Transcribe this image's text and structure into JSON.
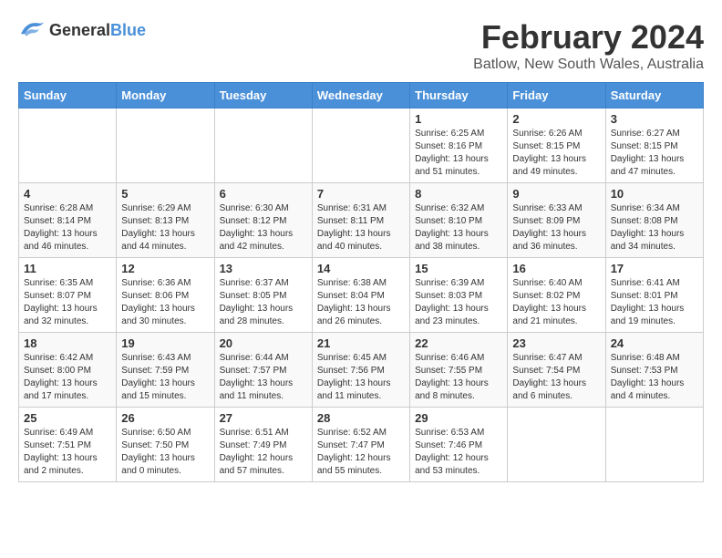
{
  "logo": {
    "general": "General",
    "blue": "Blue"
  },
  "title": "February 2024",
  "subtitle": "Batlow, New South Wales, Australia",
  "weekdays": [
    "Sunday",
    "Monday",
    "Tuesday",
    "Wednesday",
    "Thursday",
    "Friday",
    "Saturday"
  ],
  "weeks": [
    [
      {
        "day": "",
        "info": ""
      },
      {
        "day": "",
        "info": ""
      },
      {
        "day": "",
        "info": ""
      },
      {
        "day": "",
        "info": ""
      },
      {
        "day": "1",
        "info": "Sunrise: 6:25 AM\nSunset: 8:16 PM\nDaylight: 13 hours\nand 51 minutes."
      },
      {
        "day": "2",
        "info": "Sunrise: 6:26 AM\nSunset: 8:15 PM\nDaylight: 13 hours\nand 49 minutes."
      },
      {
        "day": "3",
        "info": "Sunrise: 6:27 AM\nSunset: 8:15 PM\nDaylight: 13 hours\nand 47 minutes."
      }
    ],
    [
      {
        "day": "4",
        "info": "Sunrise: 6:28 AM\nSunset: 8:14 PM\nDaylight: 13 hours\nand 46 minutes."
      },
      {
        "day": "5",
        "info": "Sunrise: 6:29 AM\nSunset: 8:13 PM\nDaylight: 13 hours\nand 44 minutes."
      },
      {
        "day": "6",
        "info": "Sunrise: 6:30 AM\nSunset: 8:12 PM\nDaylight: 13 hours\nand 42 minutes."
      },
      {
        "day": "7",
        "info": "Sunrise: 6:31 AM\nSunset: 8:11 PM\nDaylight: 13 hours\nand 40 minutes."
      },
      {
        "day": "8",
        "info": "Sunrise: 6:32 AM\nSunset: 8:10 PM\nDaylight: 13 hours\nand 38 minutes."
      },
      {
        "day": "9",
        "info": "Sunrise: 6:33 AM\nSunset: 8:09 PM\nDaylight: 13 hours\nand 36 minutes."
      },
      {
        "day": "10",
        "info": "Sunrise: 6:34 AM\nSunset: 8:08 PM\nDaylight: 13 hours\nand 34 minutes."
      }
    ],
    [
      {
        "day": "11",
        "info": "Sunrise: 6:35 AM\nSunset: 8:07 PM\nDaylight: 13 hours\nand 32 minutes."
      },
      {
        "day": "12",
        "info": "Sunrise: 6:36 AM\nSunset: 8:06 PM\nDaylight: 13 hours\nand 30 minutes."
      },
      {
        "day": "13",
        "info": "Sunrise: 6:37 AM\nSunset: 8:05 PM\nDaylight: 13 hours\nand 28 minutes."
      },
      {
        "day": "14",
        "info": "Sunrise: 6:38 AM\nSunset: 8:04 PM\nDaylight: 13 hours\nand 26 minutes."
      },
      {
        "day": "15",
        "info": "Sunrise: 6:39 AM\nSunset: 8:03 PM\nDaylight: 13 hours\nand 23 minutes."
      },
      {
        "day": "16",
        "info": "Sunrise: 6:40 AM\nSunset: 8:02 PM\nDaylight: 13 hours\nand 21 minutes."
      },
      {
        "day": "17",
        "info": "Sunrise: 6:41 AM\nSunset: 8:01 PM\nDaylight: 13 hours\nand 19 minutes."
      }
    ],
    [
      {
        "day": "18",
        "info": "Sunrise: 6:42 AM\nSunset: 8:00 PM\nDaylight: 13 hours\nand 17 minutes."
      },
      {
        "day": "19",
        "info": "Sunrise: 6:43 AM\nSunset: 7:59 PM\nDaylight: 13 hours\nand 15 minutes."
      },
      {
        "day": "20",
        "info": "Sunrise: 6:44 AM\nSunset: 7:57 PM\nDaylight: 13 hours\nand 11 minutes."
      },
      {
        "day": "21",
        "info": "Sunrise: 6:45 AM\nSunset: 7:56 PM\nDaylight: 13 hours\nand 11 minutes."
      },
      {
        "day": "22",
        "info": "Sunrise: 6:46 AM\nSunset: 7:55 PM\nDaylight: 13 hours\nand 8 minutes."
      },
      {
        "day": "23",
        "info": "Sunrise: 6:47 AM\nSunset: 7:54 PM\nDaylight: 13 hours\nand 6 minutes."
      },
      {
        "day": "24",
        "info": "Sunrise: 6:48 AM\nSunset: 7:53 PM\nDaylight: 13 hours\nand 4 minutes."
      }
    ],
    [
      {
        "day": "25",
        "info": "Sunrise: 6:49 AM\nSunset: 7:51 PM\nDaylight: 13 hours\nand 2 minutes."
      },
      {
        "day": "26",
        "info": "Sunrise: 6:50 AM\nSunset: 7:50 PM\nDaylight: 13 hours\nand 0 minutes."
      },
      {
        "day": "27",
        "info": "Sunrise: 6:51 AM\nSunset: 7:49 PM\nDaylight: 12 hours\nand 57 minutes."
      },
      {
        "day": "28",
        "info": "Sunrise: 6:52 AM\nSunset: 7:47 PM\nDaylight: 12 hours\nand 55 minutes."
      },
      {
        "day": "29",
        "info": "Sunrise: 6:53 AM\nSunset: 7:46 PM\nDaylight: 12 hours\nand 53 minutes."
      },
      {
        "day": "",
        "info": ""
      },
      {
        "day": "",
        "info": ""
      }
    ]
  ]
}
